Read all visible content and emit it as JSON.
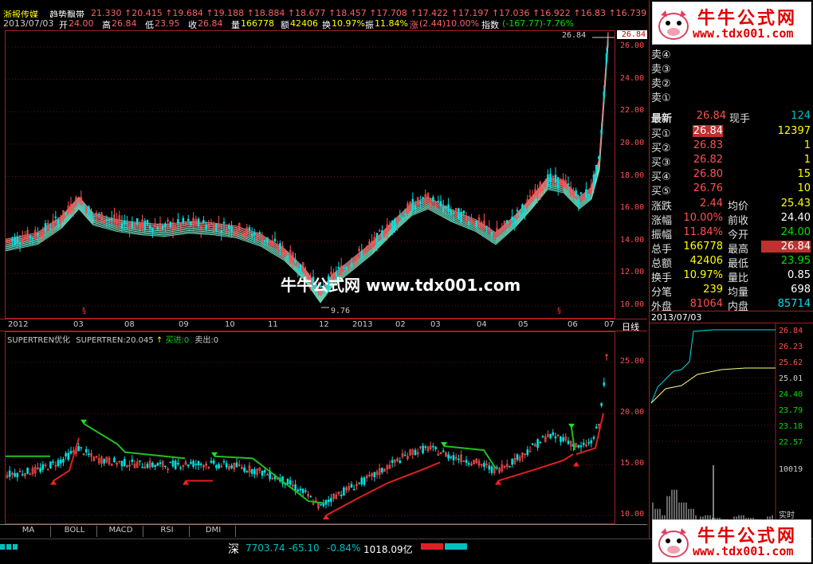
{
  "title": {
    "stock_name": "浙报传媒",
    "indicator": "趋势飘带",
    "levels": [
      "21.330",
      "20.415",
      "19.684",
      "19.188",
      "18.884",
      "18.677",
      "18.457",
      "17.708",
      "17.422",
      "17.197",
      "17.036",
      "16.922",
      "16.83",
      "16.739"
    ]
  },
  "info": {
    "date": "2013/07/03",
    "open_label": "开",
    "open": "24.00",
    "high_label": "高",
    "high": "26.84",
    "low_label": "低",
    "low": "23.95",
    "close_label": "收",
    "close": "26.84",
    "vol_label": "量",
    "vol": "166778",
    "amt_label": "额",
    "amt": "42406",
    "turn_label": "换",
    "turn": "10.97%",
    "amp_label": "振",
    "amp": "11.84%",
    "chg_label": "涨",
    "chg": "(2.44)10.00%",
    "idx_label": "指数",
    "idx": "(-167.77)-7.76%"
  },
  "main_chart": {
    "yticks": [
      "26.00",
      "24.00",
      "22.00",
      "20.00",
      "18.00",
      "16.00",
      "14.00",
      "12.00",
      "10.00"
    ],
    "current_price_tag": "26.84",
    "high_mark": "26.84",
    "low_mark": "9.76",
    "signal_mark": "§"
  },
  "xaxis": {
    "labels": [
      "2012",
      "03",
      "08",
      "09",
      "10",
      "11",
      "12",
      "2013",
      "02",
      "03",
      "04",
      "05",
      "06",
      "07"
    ],
    "period": "日线"
  },
  "indicator_chart": {
    "name": "SUPERTREN优化",
    "value_label": "SUPERTREN:20.045",
    "buy_label": "买进:0",
    "sell_label": "卖出:0",
    "yticks": [
      "25.00",
      "20.00",
      "15.00",
      "10.00"
    ]
  },
  "tabs": [
    "MA",
    "BOLL",
    "MACD",
    "RSI",
    "DMI"
  ],
  "status": {
    "market": "深",
    "index": "7703.74",
    "change": "-65.10",
    "pct": "-0.84%",
    "amount": "1018.09亿"
  },
  "quote": {
    "sell_labels": [
      "卖⑤",
      "卖④",
      "卖③",
      "卖②",
      "卖①"
    ],
    "latest_label": "最新",
    "latest": "26.84",
    "cur_hand_label": "现手",
    "cur_hand": "124",
    "buys": [
      {
        "label": "买①",
        "price": "26.84",
        "vol": "12397"
      },
      {
        "label": "买②",
        "price": "26.83",
        "vol": "1"
      },
      {
        "label": "买③",
        "price": "26.82",
        "vol": "1"
      },
      {
        "label": "买④",
        "price": "26.80",
        "vol": "15"
      },
      {
        "label": "买⑤",
        "price": "26.76",
        "vol": "10"
      }
    ],
    "rows": [
      {
        "l1": "涨跌",
        "v1": "2.44",
        "l2": "均价",
        "v2": "25.43"
      },
      {
        "l1": "涨幅",
        "v1": "10.00%",
        "l2": "前收",
        "v2": "24.40"
      },
      {
        "l1": "振幅",
        "v1": "11.84%",
        "l2": "今开",
        "v2": "24.00"
      },
      {
        "l1": "总手",
        "v1": "166778",
        "l2": "最高",
        "v2": "26.84"
      },
      {
        "l1": "总额",
        "v1": "42406",
        "l2": "最低",
        "v2": "23.95"
      },
      {
        "l1": "换手",
        "v1": "10.97%",
        "l2": "量比",
        "v2": "0.85"
      },
      {
        "l1": "分笔",
        "v1": "239",
        "l2": "均量",
        "v2": "698"
      },
      {
        "l1": "外盘",
        "v1": "81064",
        "l2": "内盘",
        "v2": "85714"
      }
    ]
  },
  "intraday": {
    "date": "2013/07/03",
    "yticks": [
      "26.84",
      "26.23",
      "25.62",
      "25.01",
      "24.40",
      "23.79",
      "23.18",
      "22.57"
    ],
    "vol_max": "10019",
    "mode_label": "实时"
  },
  "watermark": {
    "logo_text": "牛牛公式网",
    "url": "www.tdx001.com",
    "center": "牛牛公式网 www.tdx001.com"
  },
  "colors": {
    "up": "#ff5050",
    "down": "#00e0e0",
    "ma_band": "#e08080",
    "support": "#e02020",
    "resist": "#20c020"
  }
}
